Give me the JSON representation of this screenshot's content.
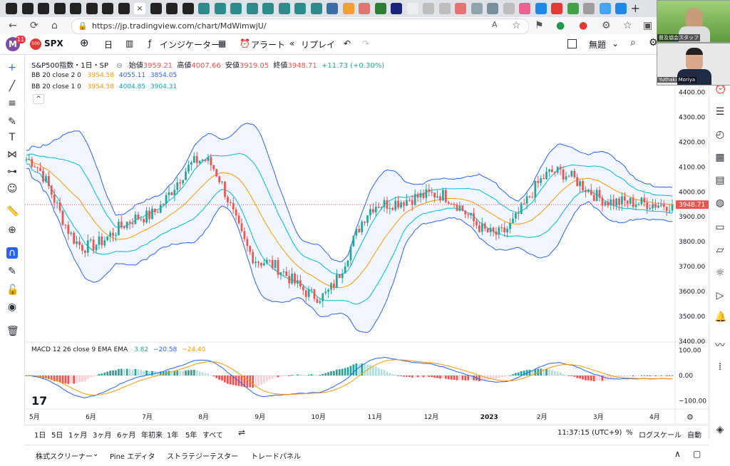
{
  "browser": {
    "url": "https://jp.tradingview.com/chart/MdWimwjU/"
  },
  "header": {
    "avatar_letter": "M",
    "notif_count": "11",
    "symbol_badge": "500",
    "symbol": "SPX",
    "interval": "日",
    "indicators_label": "インジケーター",
    "alert_label": "アラート",
    "replay_label": "リプレイ",
    "layout_name": "無題"
  },
  "legend": {
    "title": "S&P500指数・1日・SP",
    "open_label": "始値",
    "open": "3959.21",
    "high_label": "高値",
    "high": "4007.66",
    "low_label": "安値",
    "low": "3919.05",
    "close_label": "終値",
    "close": "3948.71",
    "change": "+11.73 (+0.30%)",
    "bb2_name": "BB 20 close 2 0",
    "bb2_v1": "3954.58",
    "bb2_v2": "4055.11",
    "bb2_v3": "3854.05",
    "bb1_name": "BB 20 close 1 0",
    "bb1_v1": "3954.58",
    "bb1_v2": "4004.85",
    "bb1_v3": "3904.31",
    "macd_name": "MACD 12 26 close 9 EMA EMA",
    "macd_v1": "3.82",
    "macd_v2": "−20.58",
    "macd_v3": "−24.40"
  },
  "price_axis": [
    "4500.00",
    "4400.00",
    "4300.00",
    "4200.00",
    "4100.00",
    "4000.00",
    "3900.00",
    "3800.00",
    "3700.00",
    "3600.00",
    "3500.00",
    "3400.00"
  ],
  "price_tag": "3948.71",
  "macd_axis": [
    "100.00",
    "0.00",
    "−100.00"
  ],
  "time_axis": [
    "5月",
    "6月",
    "7月",
    "8月",
    "9月",
    "10月",
    "11月",
    "12月",
    "2023",
    "2月",
    "3月",
    "4月"
  ],
  "ranges": [
    "1日",
    "5日",
    "1ヶ月",
    "3ヶ月",
    "6ヶ月",
    "年初来",
    "1年",
    "5年",
    "すべて"
  ],
  "bottom_right": {
    "time": "11:37:15 (UTC+9)",
    "percent": "%",
    "log": "ログスケール",
    "auto": "自動"
  },
  "footer_tabs": [
    "株式スクリーナー",
    "Pine エディタ",
    "ストラテジーテスター",
    "トレードパネル"
  ],
  "webcam": {
    "person1": "普及協会スタッフ",
    "person2": "Yuthaki Moriya"
  },
  "colors": {
    "up": "#26a69a",
    "down": "#ef5350",
    "bb_outer": "#2962ff",
    "bb_inner": "#00bcd4",
    "basis": "#ff9800",
    "macd": "#2962ff",
    "signal": "#ff9800"
  },
  "chart_data": {
    "type": "candlestick",
    "symbol": "SPX",
    "ylim": [
      3400,
      4550
    ],
    "x": [
      "2022-05",
      "2022-06",
      "2022-07",
      "2022-08",
      "2022-09",
      "2022-10",
      "2022-11",
      "2022-12",
      "2023-01",
      "2023-02",
      "2023-03",
      "2023-04"
    ],
    "close_path_monthly": [
      4130,
      3780,
      3900,
      4130,
      3720,
      3580,
      3950,
      3990,
      3830,
      4080,
      3960,
      3948.71
    ],
    "last": {
      "open": 3959.21,
      "high": 4007.66,
      "low": 3919.05,
      "close": 3948.71
    },
    "macd_ylim": [
      -130,
      130
    ]
  }
}
